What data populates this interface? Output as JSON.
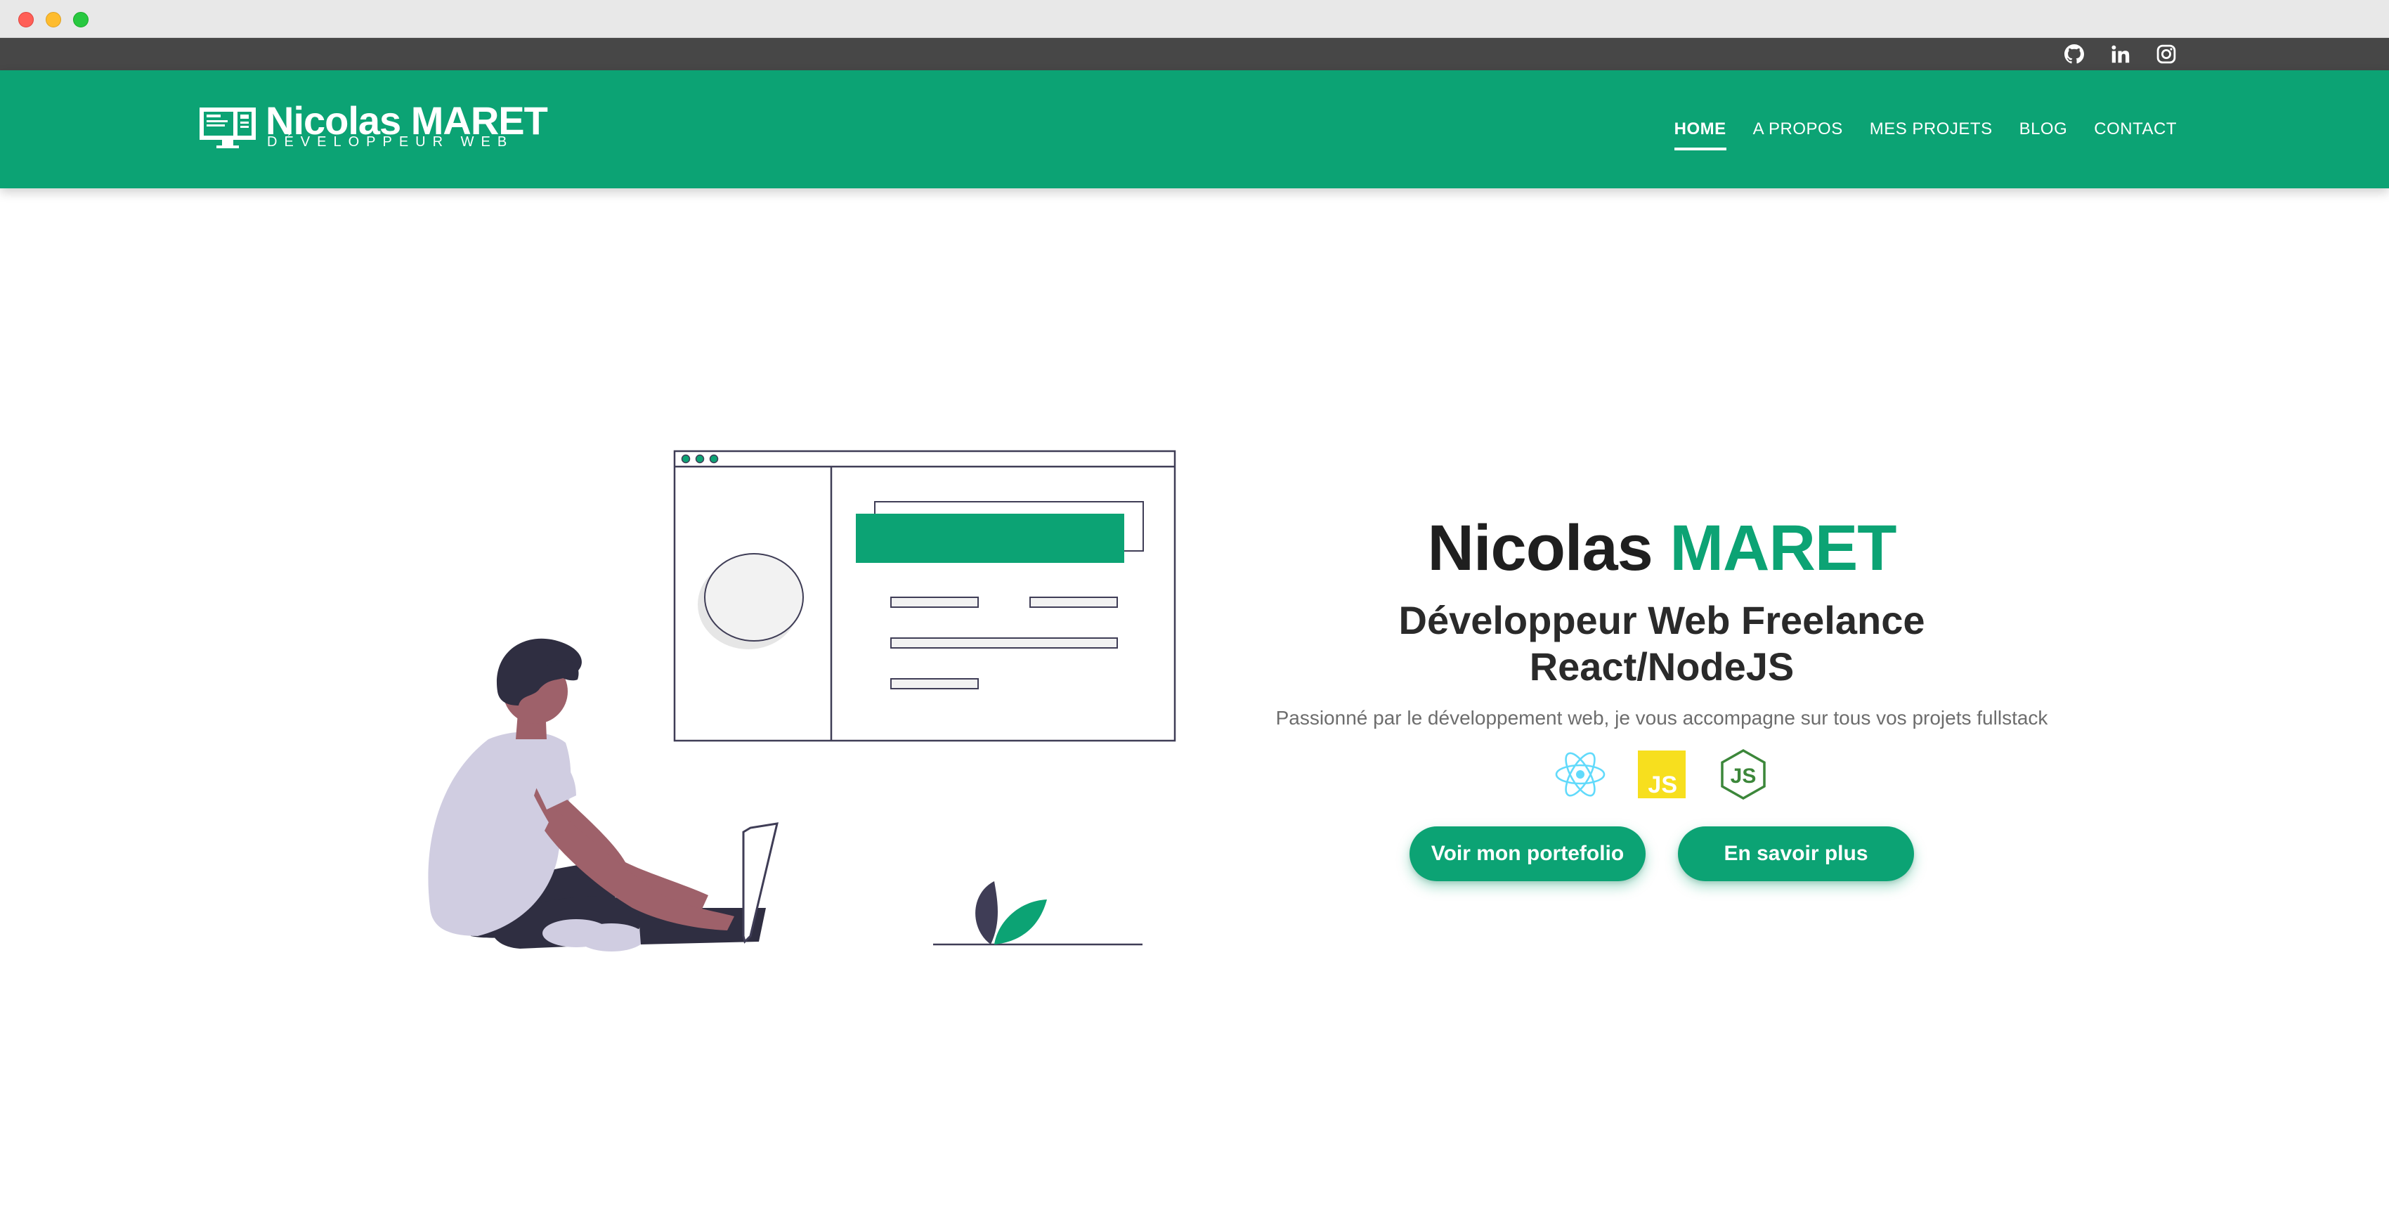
{
  "browser": {
    "traffic_lights": [
      "close",
      "minimize",
      "maximize"
    ]
  },
  "topbar": {
    "social": [
      {
        "icon": "github-icon"
      },
      {
        "icon": "linkedin-icon"
      },
      {
        "icon": "instagram-icon"
      }
    ]
  },
  "header": {
    "logo": {
      "name": "Nicolas MARET",
      "subtitle": "DÉVELOPPEUR WEB"
    },
    "nav": [
      {
        "label": "HOME",
        "active": true
      },
      {
        "label": "A PROPOS",
        "active": false
      },
      {
        "label": "MES PROJETS",
        "active": false
      },
      {
        "label": "BLOG",
        "active": false
      },
      {
        "label": "CONTACT",
        "active": false
      }
    ]
  },
  "hero": {
    "first_name": "Nicolas",
    "last_name": "MARET",
    "role_line1": "Développeur Web Freelance",
    "role_line2": "React/NodeJS",
    "description": "Passionné par le développement web, je vous accompagne sur tous vos projets fullstack",
    "tech_icons": [
      "react-icon",
      "javascript-icon",
      "nodejs-icon"
    ],
    "js_badge_text": "JS",
    "buttons": {
      "portfolio": "Voir mon portefolio",
      "more": "En savoir plus"
    }
  },
  "colors": {
    "brand_green": "#0ca374",
    "topbar": "#474747",
    "text_dark": "#1f1f1f",
    "text_muted": "#6d6d6d",
    "react_blue": "#61dafb",
    "js_yellow": "#f7df1e",
    "node_green": "#3c873a"
  }
}
